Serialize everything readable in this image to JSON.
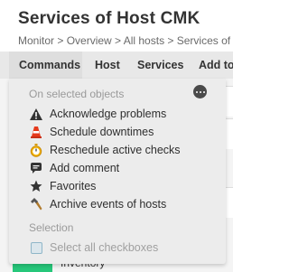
{
  "header": {
    "title": "Services of Host CMK",
    "breadcrumb": "Monitor > Overview > All hosts > Services of Host CMK"
  },
  "menubar": {
    "items": [
      "Commands",
      "Host",
      "Services",
      "Add to"
    ]
  },
  "dropdown": {
    "section_selected": "On selected objects",
    "items": [
      {
        "label": "Acknowledge problems",
        "icon": "warning-triangle-icon"
      },
      {
        "label": "Schedule downtimes",
        "icon": "traffic-cone-icon"
      },
      {
        "label": "Reschedule active checks",
        "icon": "stopwatch-icon"
      },
      {
        "label": "Add comment",
        "icon": "speech-bubble-icon"
      },
      {
        "label": "Favorites",
        "icon": "star-icon"
      },
      {
        "label": "Archive events of hosts",
        "icon": "hammer-icon"
      }
    ],
    "section_selection": "Selection",
    "select_all": "Select all checkboxes"
  },
  "background": {
    "inventory_label": "Inventory"
  },
  "colors": {
    "accent_green": "#26c77a",
    "menubar_bg": "#e8e8e8",
    "dropdown_bg": "#ececec"
  }
}
